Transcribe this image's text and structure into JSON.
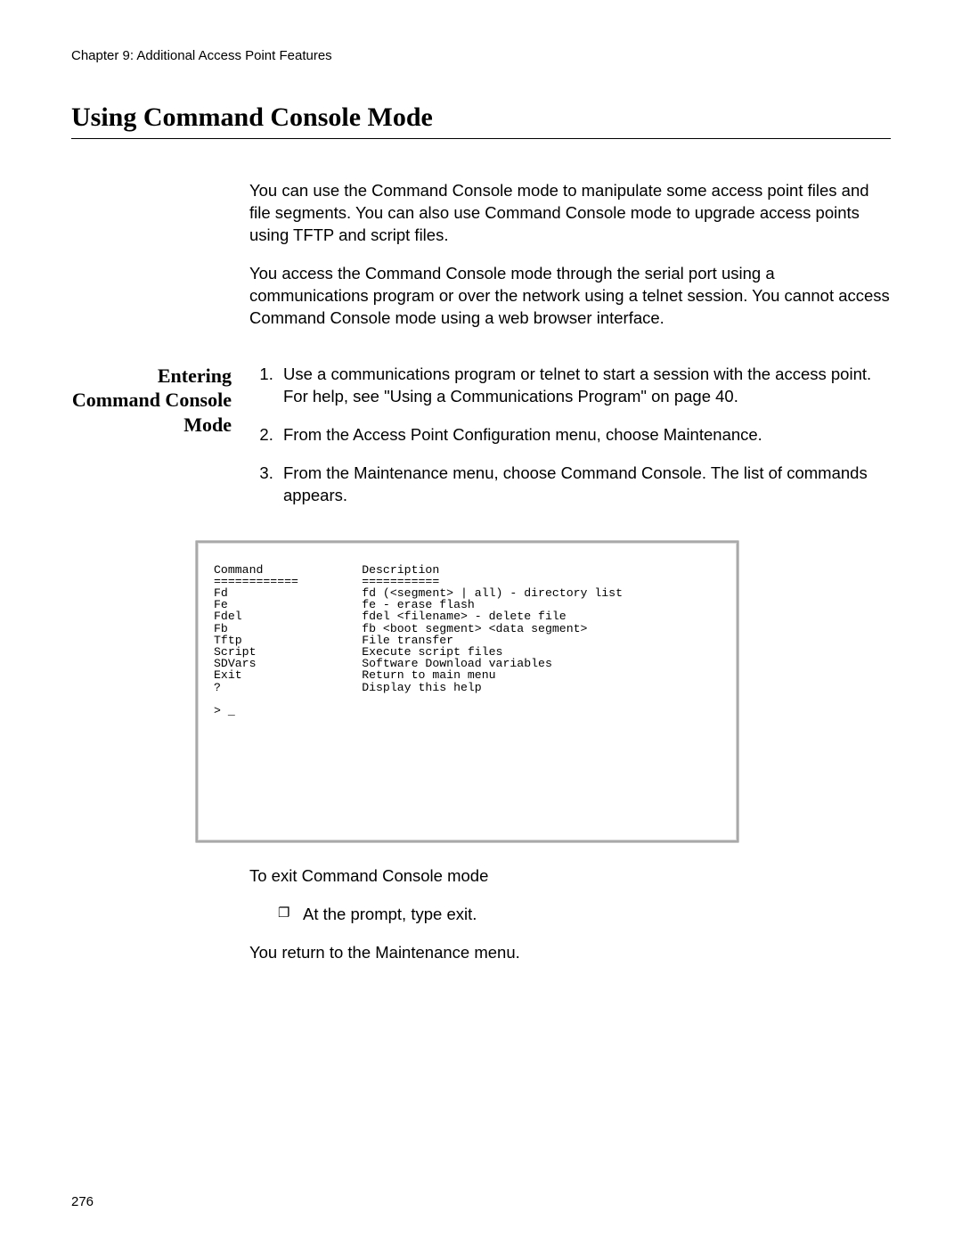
{
  "chapter_header": "Chapter 9: Additional Access Point Features",
  "main_title": "Using Command Console Mode",
  "intro_para1": "You can use the Command Console mode to manipulate some access point files and file segments. You can also use Command Console mode to upgrade access points using TFTP and script files.",
  "intro_para2": "You access the Command Console mode through the serial port using a communications program or over the network using a telnet session. You cannot access Command Console mode using a web browser interface.",
  "side_heading": "Entering Command Console Mode",
  "steps": {
    "s1": "Use a communications program or telnet to start a session with the access point. For help, see \"Using a Communications Program\" on page 40.",
    "s2": "From the Access Point Configuration menu, choose Maintenance.",
    "s3": "From the Maintenance menu, choose Command Console. The list of commands appears."
  },
  "console_text": "Command              Description\n============         ===========\nFd                   fd (<segment> | all) - directory list\nFe                   fe - erase flash\nFdel                 fdel <filename> - delete file\nFb                   fb <boot segment> <data segment>\nTftp                 File transfer\nScript               Execute script files\nSDVars               Software Download variables\nExit                 Return to main menu\n?                    Display this help\n\n> _",
  "exit_heading": "To exit Command Console mode",
  "exit_bullet": "At the prompt, type exit.",
  "exit_after": "You return to the Maintenance menu.",
  "page_number": "276"
}
